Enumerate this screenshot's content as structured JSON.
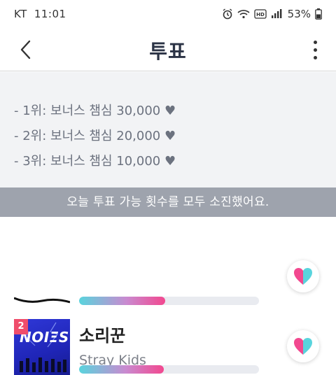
{
  "status_bar": {
    "carrier": "KT",
    "time": "11:01",
    "battery": "53%"
  },
  "header": {
    "title": "투표"
  },
  "bonus_info": [
    "- 1위: 보너스 챔심 30,000 ♥",
    "- 2위: 보너스 챔심 20,000 ♥",
    "- 3위: 보너스 챔심 10,000 ♥"
  ],
  "notice": "오늘 투표 가능 횟수를 모두 소진했어요.",
  "candidates": [
    {
      "title": "",
      "artist": "",
      "vote_progress": 0.48
    },
    {
      "title": "소리꾼",
      "artist": "Stray Kids",
      "album_cover_text": "NOIΞSY",
      "rank": "2",
      "vote_progress": 0.47
    }
  ],
  "colors": {
    "accent_pink": "#f2488f",
    "accent_cyan": "#59d4dd",
    "notice_bg": "#9ea3ad",
    "panel_bg": "#f2f3f5"
  },
  "icons": {
    "back": "chevron-left-icon",
    "more": "more-vertical-icon",
    "vote": "heart-icon"
  }
}
